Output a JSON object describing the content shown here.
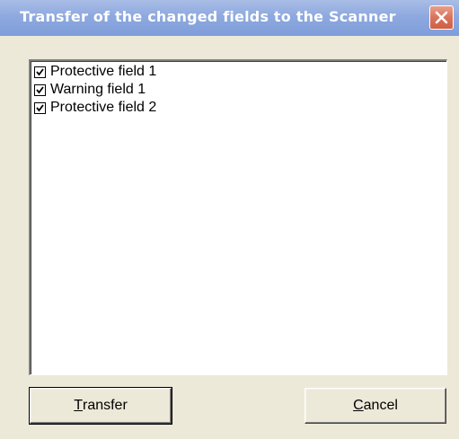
{
  "window": {
    "title": "Transfer of the changed fields to the Scanner"
  },
  "title_bar": {
    "close_icon": "close-icon"
  },
  "field_list": {
    "items": [
      {
        "label": "Protective field 1",
        "checked": true
      },
      {
        "label": "Warning field 1",
        "checked": true
      },
      {
        "label": "Protective field 2",
        "checked": true
      }
    ]
  },
  "buttons": {
    "transfer": {
      "accel": "T",
      "rest": "ransfer"
    },
    "cancel": {
      "accel": "C",
      "rest": "ancel"
    }
  },
  "colors": {
    "titlebar": "#8ea9df",
    "close_button": "#d9735b",
    "dialog_face": "#ece9d8"
  }
}
